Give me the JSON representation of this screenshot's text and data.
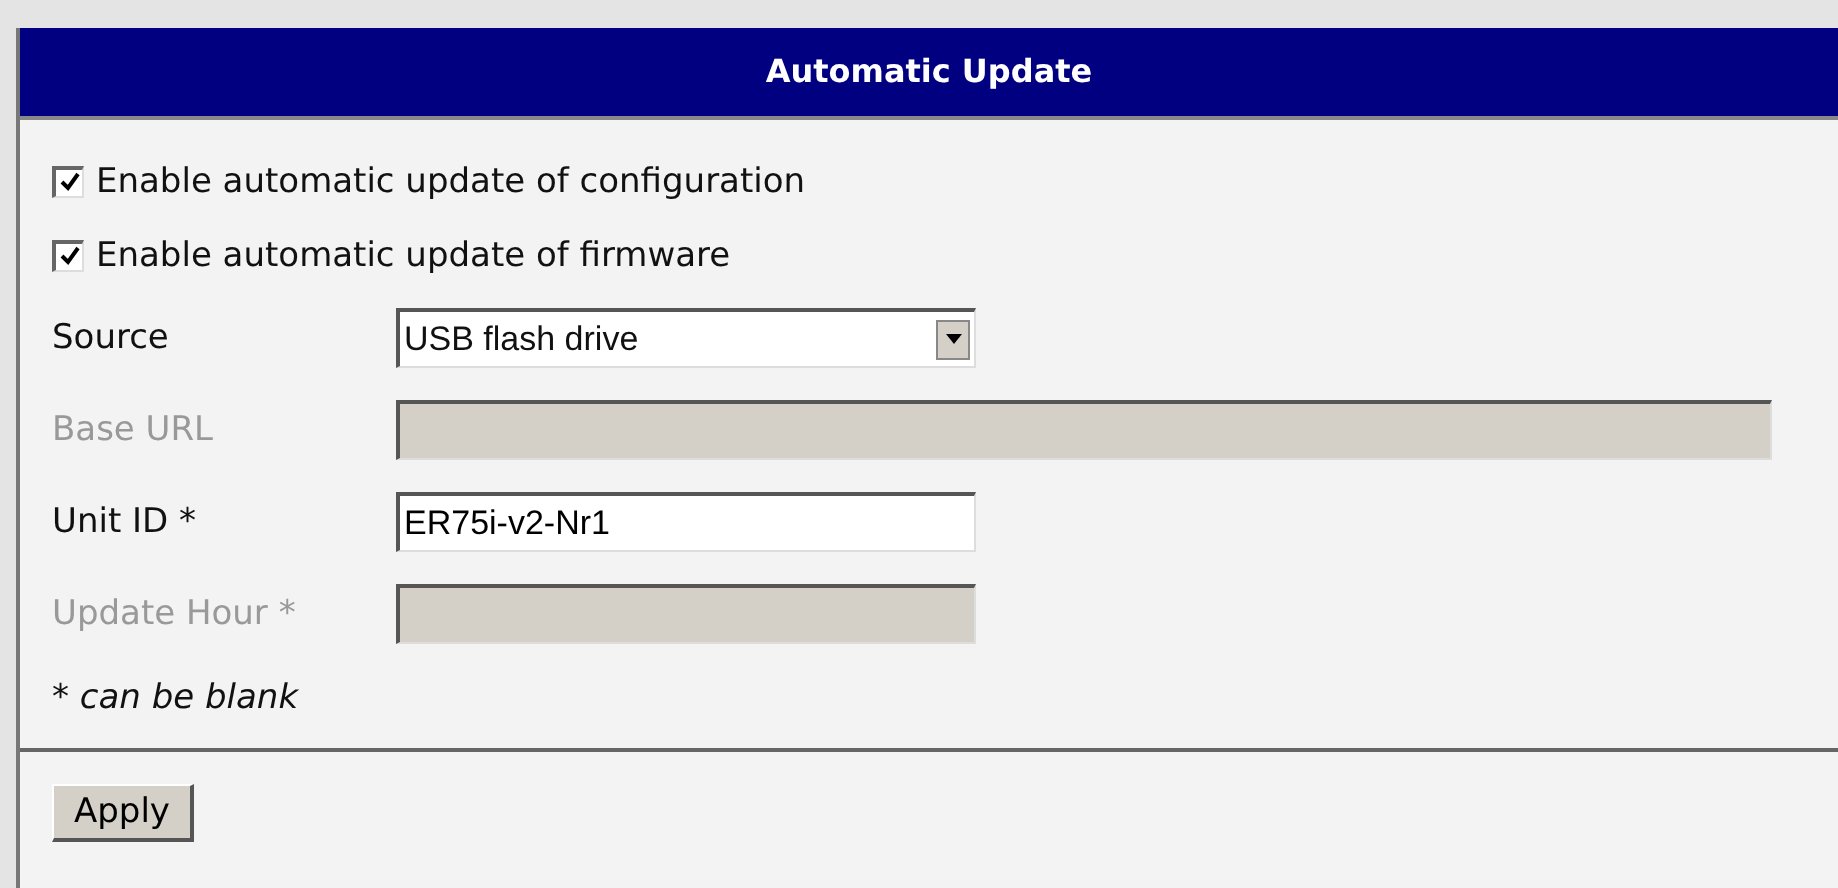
{
  "panel": {
    "title": "Automatic Update"
  },
  "checkboxes": [
    {
      "label": "Enable automatic update of configuration",
      "checked": true
    },
    {
      "label": "Enable automatic update of firmware",
      "checked": true
    }
  ],
  "fields": [
    {
      "kind": "select",
      "label": "Source",
      "value": "USB flash drive",
      "disabled": false
    },
    {
      "kind": "wide",
      "label": "Base URL",
      "disabled": true
    },
    {
      "kind": "text",
      "label": "Unit ID *",
      "value": "ER75i-v2-Nr1",
      "disabled": false
    },
    {
      "kind": "text",
      "label": "Update Hour *",
      "disabled": true
    }
  ],
  "note": "* can be blank",
  "buttons": [
    "Apply"
  ]
}
